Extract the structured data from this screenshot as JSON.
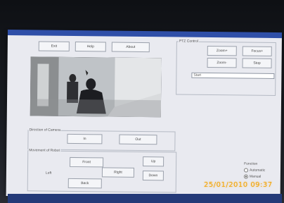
{
  "toolbar": {
    "exit": "Exit",
    "help": "Help",
    "about": "About"
  },
  "ptz": {
    "title": "PTZ Control",
    "buttons": [
      "Zoom+",
      "Focus+",
      "Zoom-",
      "Stop"
    ],
    "field_value": "Start"
  },
  "direction": {
    "title": "Direction of Camera",
    "b1": "In",
    "b2": "Out"
  },
  "movement": {
    "title": "Movement of Robot",
    "front": "Front",
    "left": "Left",
    "right": "Right",
    "back": "Back",
    "up": "Up",
    "down": "Down"
  },
  "extra": {
    "label": "Function",
    "opt1": "Automatic",
    "opt2": "Manual"
  },
  "timestamp": "25/01/2010 09:37",
  "colors": {
    "window_bg": "#e9eaf0",
    "titlebar": "#2f4fa8",
    "stamp": "#f2a400"
  }
}
